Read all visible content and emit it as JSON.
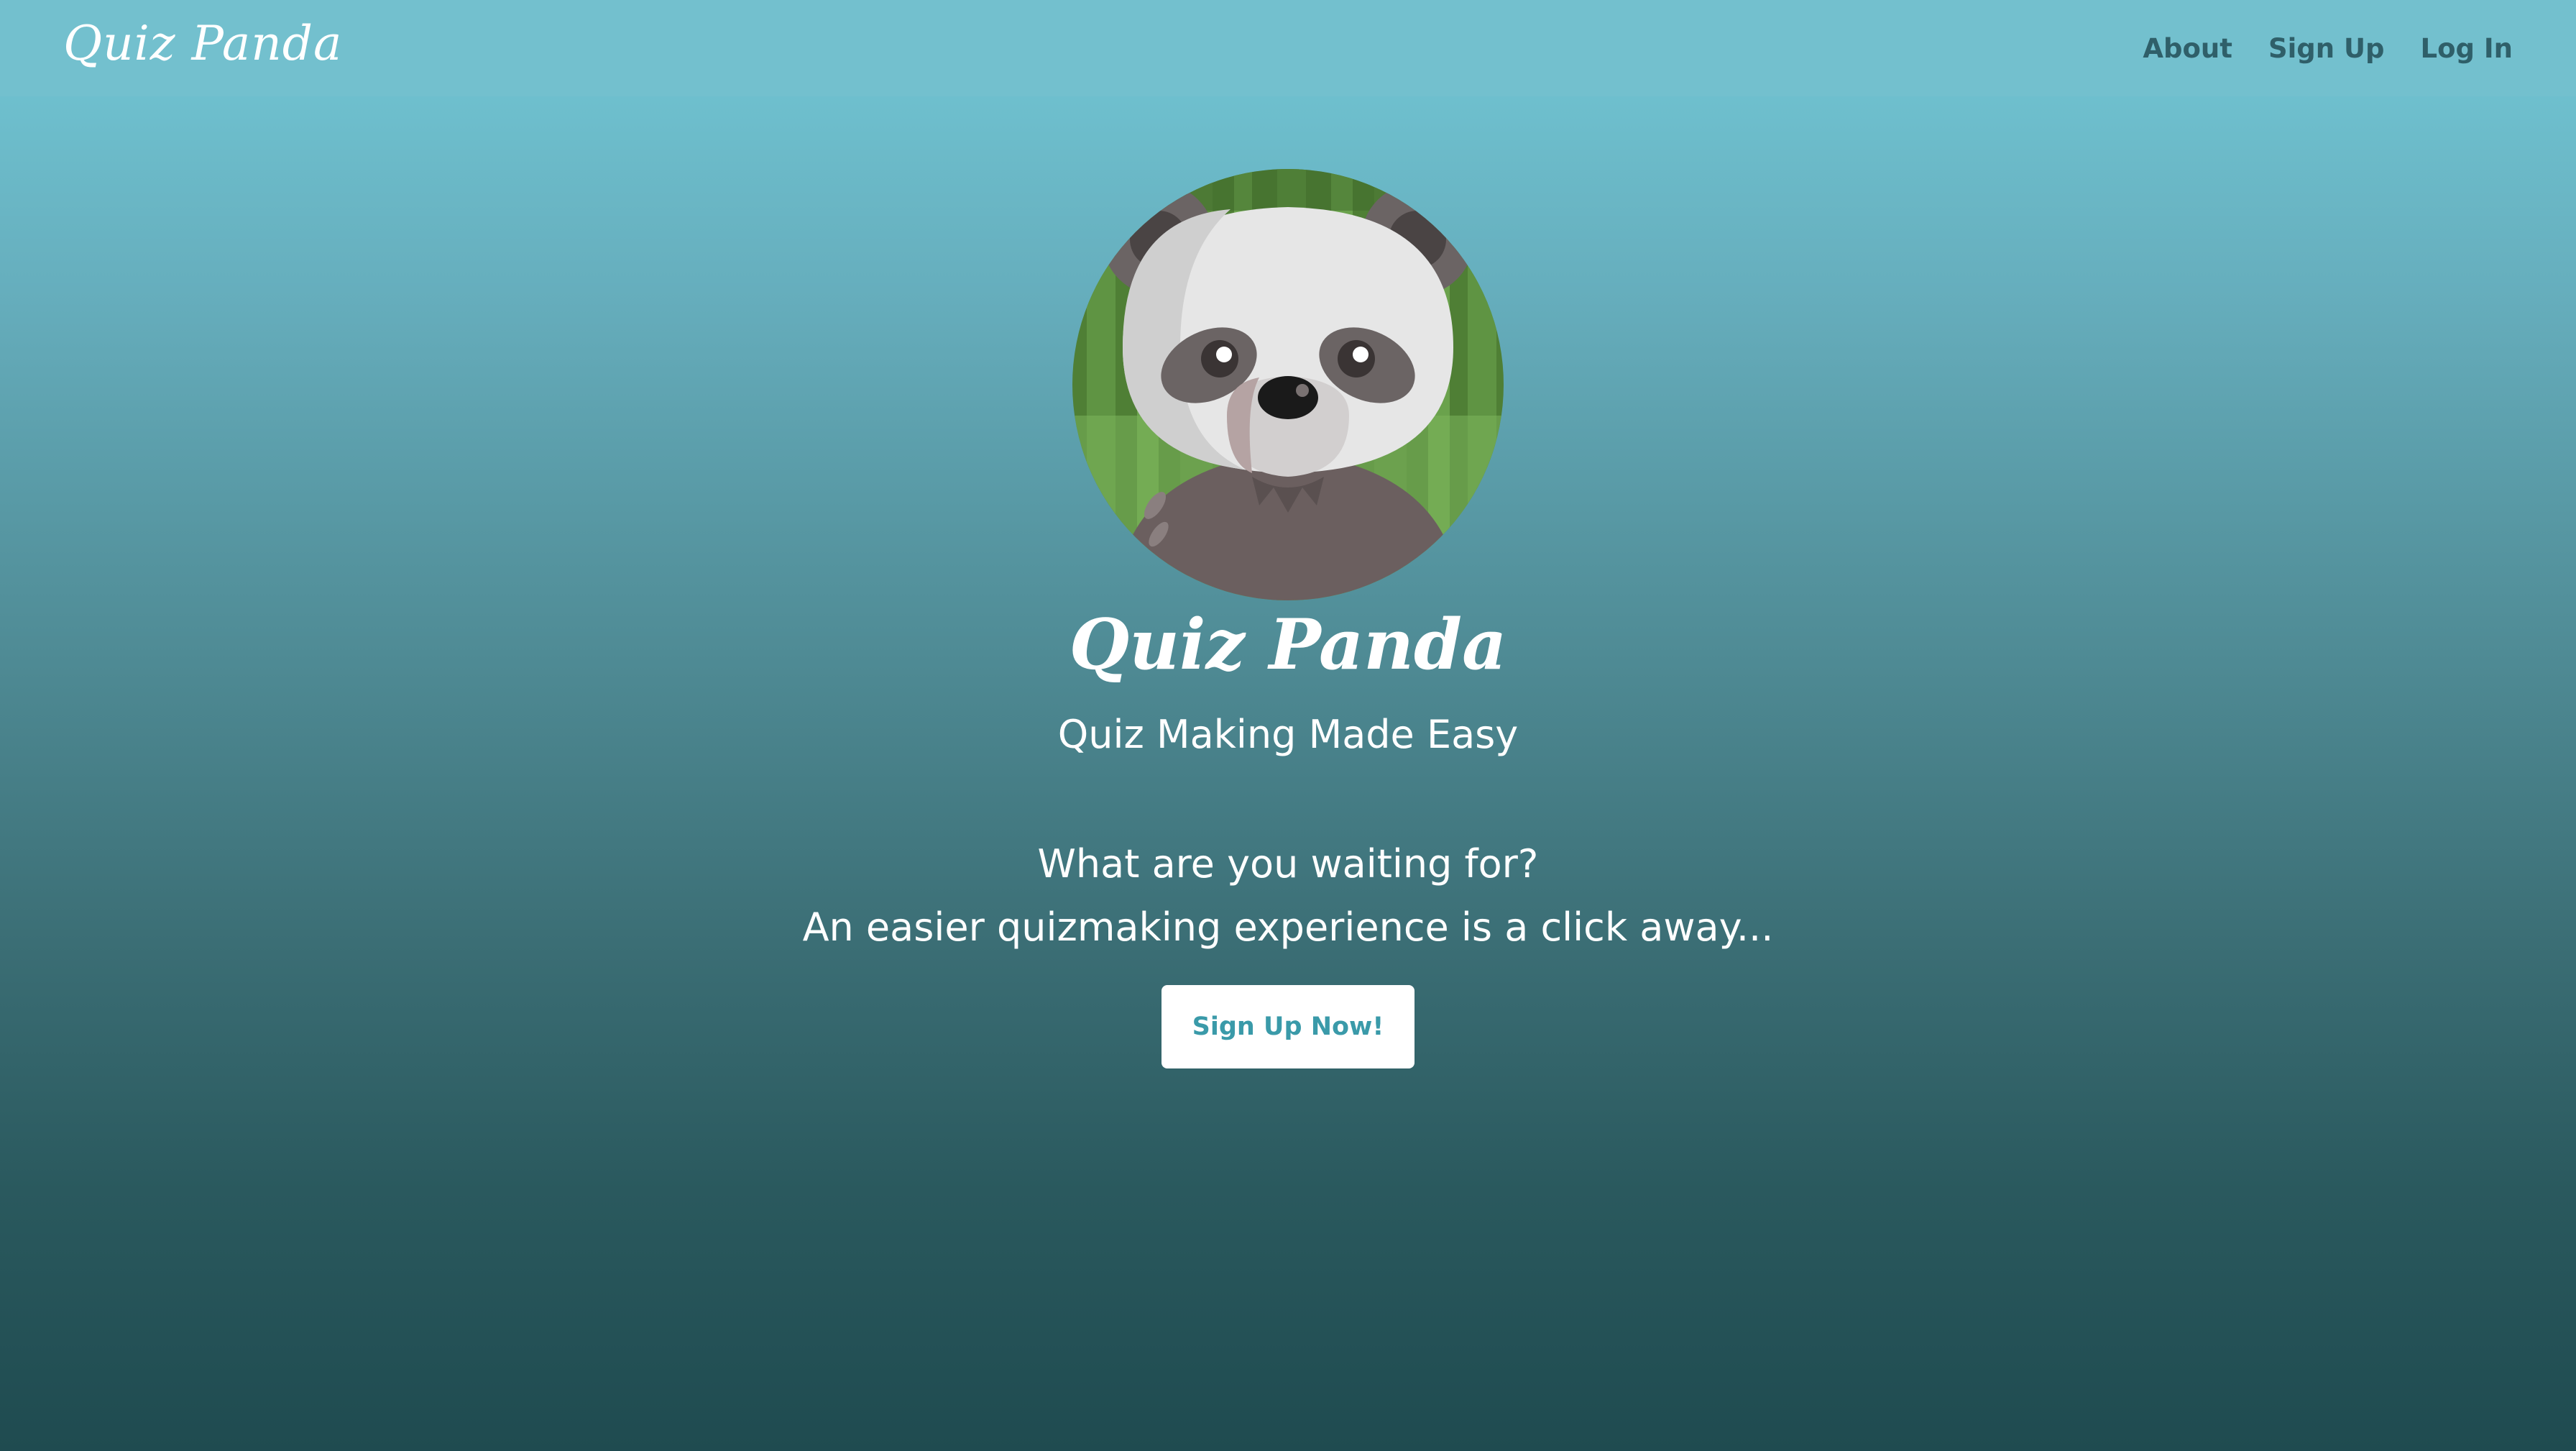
{
  "navbar": {
    "brand": "Quiz Panda",
    "links": [
      {
        "label": "About"
      },
      {
        "label": "Sign Up"
      },
      {
        "label": "Log In"
      }
    ]
  },
  "hero": {
    "title": "Quiz Panda",
    "subtitle": "Quiz Making Made Easy",
    "tagline_1": "What are you waiting for?",
    "tagline_2": "An easier quizmaking experience is a click away...",
    "cta_label": "Sign Up Now!",
    "avatar_icon": "panda-icon"
  },
  "colors": {
    "navbar_bg": "#73c0ce",
    "nav_link": "#2f5f69",
    "gradient_top": "#72c8d6",
    "gradient_bottom": "#1f4b50",
    "cta_text": "#3a9aa9",
    "bamboo_green": "#5a8f3e"
  }
}
